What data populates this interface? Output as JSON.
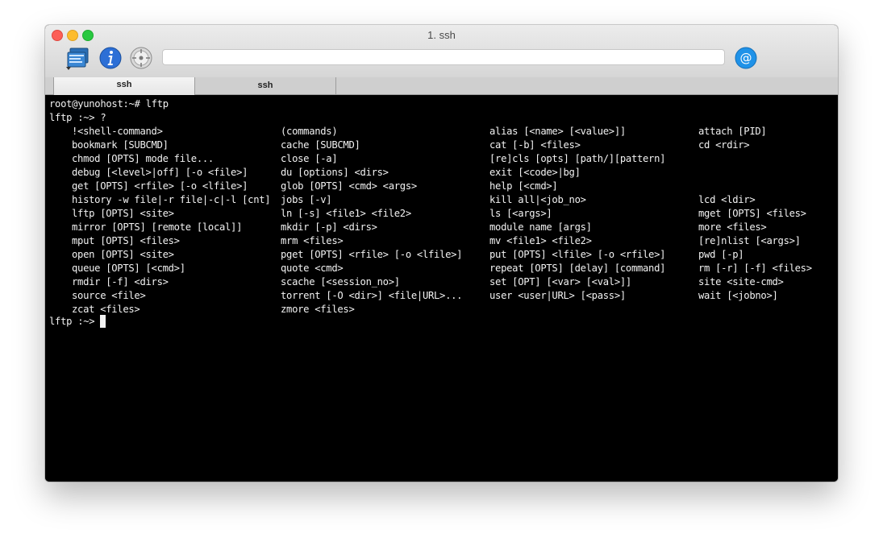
{
  "window": {
    "title": "1. ssh",
    "address_value": ""
  },
  "toolbar": {
    "icons": [
      "screens-icon",
      "info-icon",
      "dial-icon",
      "at-icon"
    ]
  },
  "tabs": [
    {
      "label": "ssh",
      "active": true
    },
    {
      "label": "ssh",
      "active": false
    }
  ],
  "terminal": {
    "prompt_line1": "root@yunohost:~# lftp",
    "prompt_line2": "lftp :~> ?",
    "prompt_last": "lftp :~> ",
    "commands": {
      "col1": [
        "!<shell-command>",
        "bookmark [SUBCMD]",
        "chmod [OPTS] mode file...",
        "debug [<level>|off] [-o <file>]",
        "get [OPTS] <rfile> [-o <lfile>]",
        "history -w file|-r file|-c|-l [cnt]",
        "lftp [OPTS] <site>",
        "mirror [OPTS] [remote [local]]",
        "mput [OPTS] <files>",
        "open [OPTS] <site>",
        "queue [OPTS] [<cmd>]",
        "rmdir [-f] <dirs>",
        "source <file>",
        "zcat <files>"
      ],
      "col2": [
        "(commands)",
        "cache [SUBCMD]",
        "close [-a]",
        "du [options] <dirs>",
        "glob [OPTS] <cmd> <args>",
        "jobs [-v]",
        "ln [-s] <file1> <file2>",
        "mkdir [-p] <dirs>",
        "mrm <files>",
        "pget [OPTS] <rfile> [-o <lfile>]",
        "quote <cmd>",
        "scache [<session_no>]",
        "torrent [-O <dir>] <file|URL>...",
        "zmore <files>"
      ],
      "col3": [
        "alias [<name> [<value>]]",
        "cat [-b] <files>",
        "[re]cls [opts] [path/][pattern]",
        "exit [<code>|bg]",
        "help [<cmd>]",
        "kill all|<job_no>",
        "ls [<args>]",
        "module name [args]",
        "mv <file1> <file2>",
        "put [OPTS] <lfile> [-o <rfile>]",
        "repeat [OPTS] [delay] [command]",
        "set [OPT] [<var> [<val>]]",
        "user <user|URL> [<pass>]",
        ""
      ],
      "col4": [
        "attach [PID]",
        "cd <rdir>",
        "",
        "",
        "",
        "lcd <ldir>",
        "mget [OPTS] <files>",
        "more <files>",
        "[re]nlist [<args>]",
        "pwd [-p]",
        "rm [-r] [-f] <files>",
        "site <site-cmd>",
        "wait [<jobno>]",
        ""
      ]
    }
  }
}
